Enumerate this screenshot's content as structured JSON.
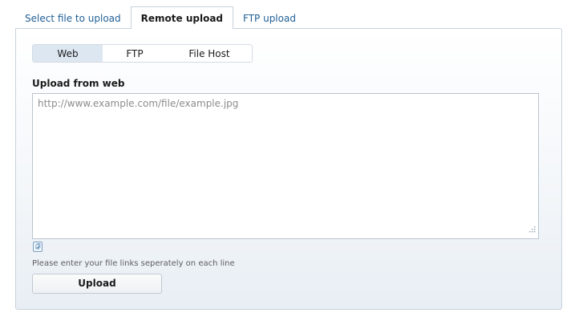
{
  "top_tabs": [
    {
      "label": "Select file to upload"
    },
    {
      "label": "Remote upload"
    },
    {
      "label": "FTP upload"
    }
  ],
  "source_selector": {
    "options": [
      {
        "label": "Web"
      },
      {
        "label": "FTP"
      },
      {
        "label": "File Host"
      }
    ],
    "selected": "Web"
  },
  "section_title": "Upload from web",
  "links_input": {
    "placeholder": "http://www.example.com/file/example.jpg",
    "value": ""
  },
  "hint": "Please enter your file links seperately on each line",
  "upload_button": {
    "label": "Upload"
  },
  "colors": {
    "accent": "#1f5f95",
    "panel_border": "#c7d2dd",
    "selected_segment": "#dde7f2"
  },
  "icons": {
    "paste": "paste-links-icon",
    "resize": "resize-grip-icon"
  }
}
